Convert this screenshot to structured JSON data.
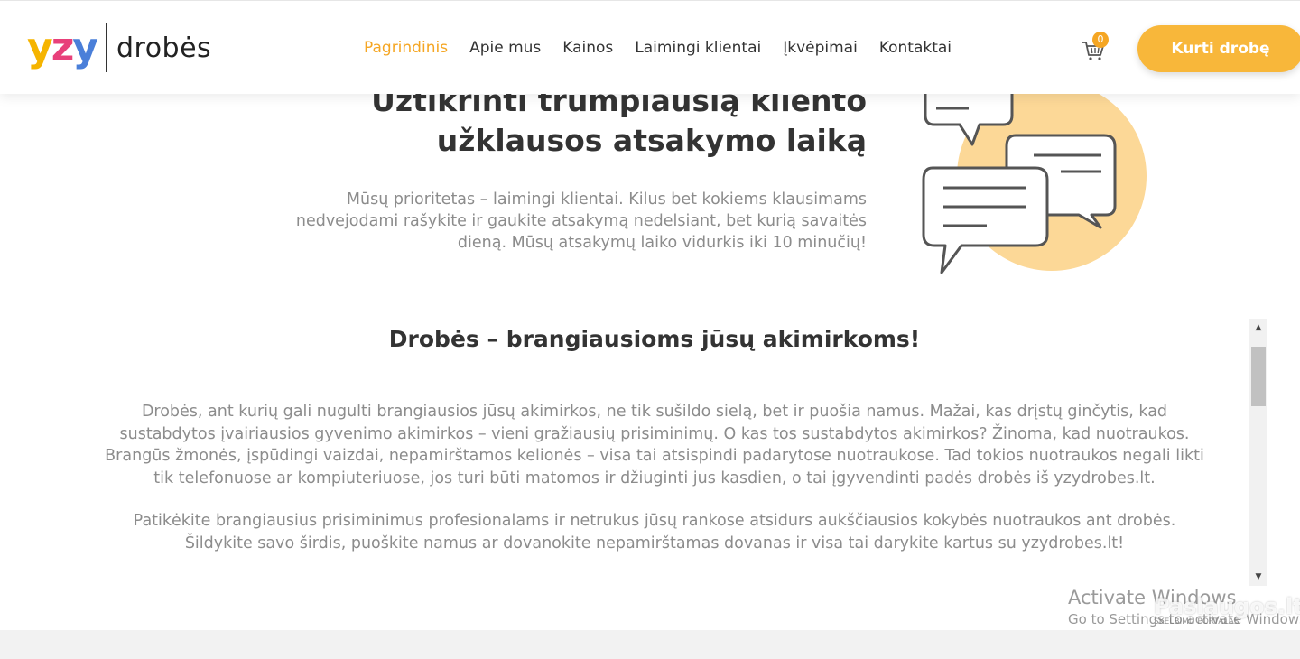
{
  "header": {
    "logo_letters": [
      "y",
      "z",
      "y"
    ],
    "logo_text": "drobės",
    "nav": [
      {
        "label": "Pagrindinis",
        "active": true
      },
      {
        "label": "Apie mus",
        "active": false
      },
      {
        "label": "Kainos",
        "active": false
      },
      {
        "label": "Laimingi klientai",
        "active": false
      },
      {
        "label": "Įkvėpimai",
        "active": false
      },
      {
        "label": "Kontaktai",
        "active": false
      }
    ],
    "cart_count": "0",
    "cta_label": "Kurti drobę",
    "accent_color": "#f8b73a"
  },
  "feature": {
    "title_line1": "Užtikrinti trumpiausią kliento",
    "title_line2": "užklausos atsakymo laiką",
    "description": "Mūsų prioritetas – laimingi klientai. Kilus bet kokiems klausimams nedvejodami rašykite ir gaukite atsakymą nedelsiant, bet kurią savaitės dieną. Mūsų atsakymų laiko vidurkis iki 10 minučių!",
    "illustration_icon": "chat-bubbles-icon"
  },
  "section": {
    "title": "Drobės – brangiausioms jūsų akimirkoms!",
    "paragraph1": "Drobės, ant kurių gali nugulti brangiausios jūsų akimirkos, ne tik sušildo sielą, bet ir puošia namus. Mažai, kas drįstų ginčytis, kad sustabdytos įvairiausios gyvenimo akimirkos – vieni gražiausių prisiminimų. O kas tos sustabdytos akimirkos? Žinoma, kad nuotraukos. Brangūs žmonės, įspūdingi vaizdai, nepamirštamos kelionės – visa tai atsispindi padarytose nuotraukose. Tad tokios nuotraukos negali likti tik telefonuose ar kompiuteriuose, jos turi būti matomos ir džiuginti jus kasdien, o tai įgyvendinti padės drobės iš yzydrobes.lt.",
    "paragraph2": "Patikėkite brangiausius prisiminimus profesionalams ir netrukus jūsų rankose atsidurs aukščiausios kokybės nuotraukos ant drobės. Šildykite savo širdis, puoškite namus ar dovanokite nepamirštamas dovanas ir visa tai darykite kartus su yzydrobes.lt!"
  },
  "watermark": {
    "windows_title": "Activate Windows",
    "windows_sub": "Go to Settings to activate Windows.",
    "site": "Paslaugos.lt",
    "site_sub": "SKELBIMU PORTALAS"
  }
}
